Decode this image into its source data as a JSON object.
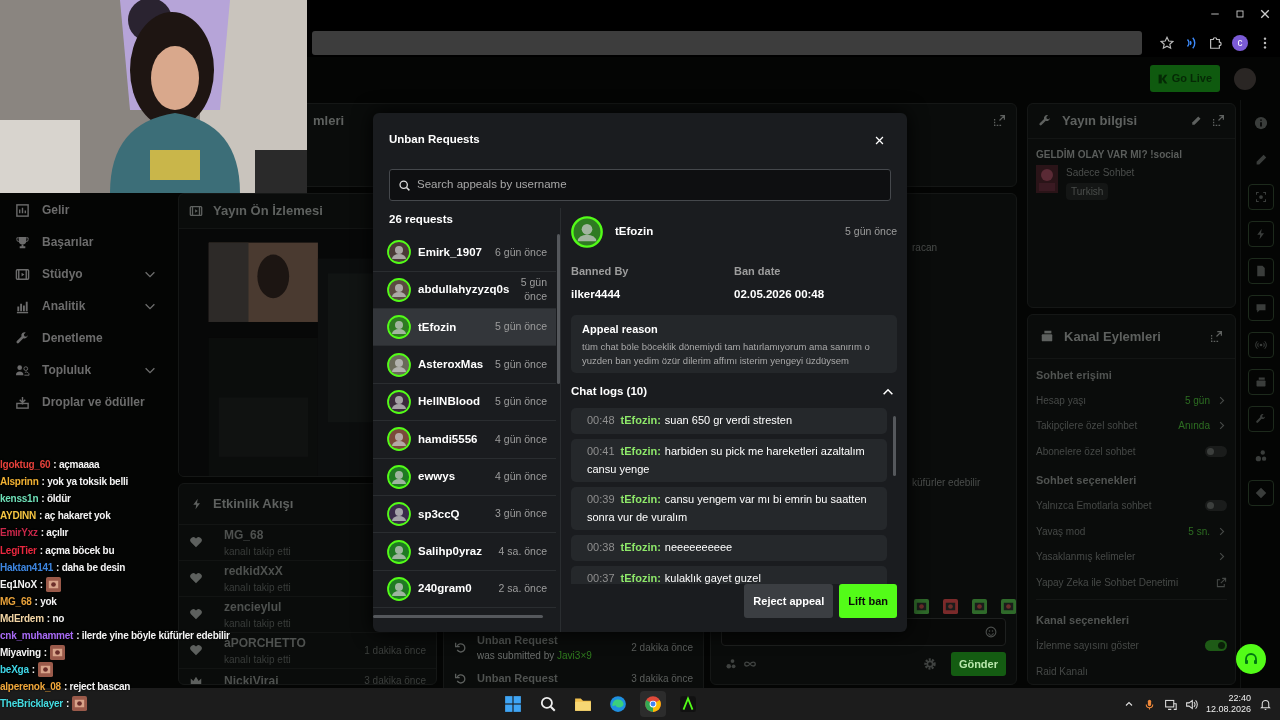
{
  "browser": {
    "profile_initial": "c"
  },
  "header": {
    "go_live": "Go Live"
  },
  "sidebar": {
    "items": [
      {
        "label": "Gelir",
        "expandable": false
      },
      {
        "label": "Başarılar",
        "expandable": false
      },
      {
        "label": "Stüdyo",
        "expandable": true
      },
      {
        "label": "Analitik",
        "expandable": true
      },
      {
        "label": "Denetleme",
        "expandable": false
      },
      {
        "label": "Topluluk",
        "expandable": true
      },
      {
        "label": "Droplar ve ödüller",
        "expandable": false
      }
    ]
  },
  "top_panel": {
    "title": "mleri"
  },
  "preview": {
    "title": "Yayın Ön İzlemesi"
  },
  "activity": {
    "title": "Etkinlik Akışı",
    "items": [
      {
        "kind": "follow",
        "name": "MG_68",
        "action": "kanalı takip etti"
      },
      {
        "kind": "follow",
        "name": "redkidXxX",
        "action": "kanalı takip etti"
      },
      {
        "kind": "follow",
        "name": "zencieylul",
        "action": "kanalı takip etti"
      },
      {
        "kind": "follow",
        "name": "aPORCHETTO",
        "action": "kanalı takip etti",
        "time": "1 dakika önce"
      },
      {
        "kind": "subscription",
        "name": "NickiVirai",
        "time": "3 dakika önce"
      }
    ]
  },
  "mod_log": {
    "items": [
      {
        "title": "Unban Request",
        "detail": "was submitted by",
        "user": "Javi3×9",
        "time": "2 dakika önce"
      },
      {
        "title": "Unban Request",
        "time": "3 dakika önce"
      }
    ]
  },
  "chat": {
    "messages": [
      "racan",
      "küfürler edebilir"
    ],
    "send": "Gönder"
  },
  "stream_info": {
    "title": "Yayın bilgisi",
    "stream_title": "GELDİM OLAY VAR MI? !social",
    "category": "Sadece Sohbet",
    "tag": "Turkish"
  },
  "channel_actions": {
    "title": "Kanal Eylemleri",
    "sections": [
      {
        "heading": "Sohbet erişimi",
        "rows": [
          {
            "kind": "value",
            "label": "Hesap yaşı",
            "value": "5 gün"
          },
          {
            "kind": "value",
            "label": "Takipçilere özel sohbet",
            "value": "Anında"
          },
          {
            "kind": "toggle",
            "label": "Abonelere özel sohbet",
            "on": false
          }
        ]
      },
      {
        "heading": "Sohbet seçenekleri",
        "rows": [
          {
            "kind": "toggle",
            "label": "Yalnızca Emotlarla sohbet",
            "on": false
          },
          {
            "kind": "value",
            "label": "Yavaş mod",
            "value": "5 sn."
          },
          {
            "kind": "link",
            "label": "Yasaklanmış kelimeler"
          },
          {
            "kind": "external",
            "label": "Yapay Zeka ile Sohbet Denetimi"
          }
        ]
      },
      {
        "heading": "Kanal seçenekleri",
        "rows": [
          {
            "kind": "toggle",
            "label": "İzlenme sayısını göster",
            "on": true
          },
          {
            "kind": "plain",
            "label": "Raid Kanalı"
          }
        ]
      }
    ]
  },
  "stream_chat": [
    {
      "user": "lgoktug_60",
      "color": "#e5413b",
      "message": ": açmaaaa"
    },
    {
      "user": "Alsprinn",
      "color": "#f2b233",
      "message": ": yok ya toksik belli"
    },
    {
      "user": "kenss1n",
      "color": "#6fe0b8",
      "message": ": öldür"
    },
    {
      "user": "AYDINN",
      "color": "#f5c542",
      "message": ": aç hakaret yok"
    },
    {
      "user": "EmirYxz",
      "color": "#c9284a",
      "message": ": açılır"
    },
    {
      "user": "LegiTier",
      "color": "#e8283f",
      "message": ": açma böcek bu"
    },
    {
      "user": "Haktan4141",
      "color": "#3d86e0",
      "message": ": daha be desin"
    },
    {
      "user": "Eq1NoX",
      "color": "#f2f2f2",
      "message": ":",
      "emote": true
    },
    {
      "user": "MG_68",
      "color": "#e8a23a",
      "message": ": yok"
    },
    {
      "user": "MdErdem",
      "color": "#f3d6a5",
      "message": ": no"
    },
    {
      "user": "cnk_muhammet",
      "color": "#a86bf5",
      "message": ": ilerde yine böyle küfürler edebilir"
    },
    {
      "user": "Miyaving",
      "color": "#f2f2f2",
      "message": ":",
      "emote": true
    },
    {
      "user": "beXga",
      "color": "#3fd6e6",
      "message": ":",
      "emote": true
    },
    {
      "user": "alperenok_08",
      "color": "#f0a73a",
      "message": ": reject bascan"
    },
    {
      "user": "TheBricklayer",
      "color": "#45dde3",
      "message": ":",
      "emote": true
    }
  ],
  "modal": {
    "title": "Unban Requests",
    "search": {
      "placeholder": "Search appeals by username"
    },
    "count": "26 requests",
    "requests": [
      {
        "name": "Emirk_1907",
        "time": "6 gün önce",
        "selected": false
      },
      {
        "name": "abdullahyzyzq0s",
        "time": "5 gün önce",
        "selected": false
      },
      {
        "name": "tEfozin",
        "time": "5 gün önce",
        "selected": true
      },
      {
        "name": "AsteroxMas",
        "time": "5 gün önce",
        "selected": false
      },
      {
        "name": "HellNBlood",
        "time": "5 gün önce",
        "selected": false
      },
      {
        "name": "hamdi5556",
        "time": "4 gün önce",
        "selected": false
      },
      {
        "name": "ewwys",
        "time": "4 gün önce",
        "selected": false
      },
      {
        "name": "sp3ccQ",
        "time": "3 gün önce",
        "selected": false
      },
      {
        "name": "Salihp0yraz",
        "time": "4 sa. önce",
        "selected": false
      },
      {
        "name": "240gram0",
        "time": "2 sa. önce",
        "selected": false
      }
    ],
    "detail": {
      "name": "tEfozin",
      "time": "5 gün önce",
      "banned_by_label": "Banned By",
      "banned_by": "ilker4444",
      "ban_date_label": "Ban date",
      "ban_date": "02.05.2026 00:48",
      "appeal_title": "Appeal reason",
      "appeal_text": "tüm chat böle böceklik dönemiydi tam hatırlamıyorum ama sanırım o yuzden ban yedim özür dilerim affımı isterim yengeyi üzdüysem",
      "logs_title": "Chat logs (10)",
      "logs_expanded": true,
      "logs": [
        {
          "time": "00:48",
          "user": "tEfozin:",
          "text": "suan 650 gr verdi stresten"
        },
        {
          "time": "00:41",
          "user": "tEfozin:",
          "text": "harbiden su pick me hareketleri azaltalım cansu yenge"
        },
        {
          "time": "00:39",
          "user": "tEfozin:",
          "text": "cansu yengem var mı bi emrin bu saatten sonra vur de vuralım"
        },
        {
          "time": "00:38",
          "user": "tEfozin:",
          "text": "neeeeeeeeee"
        },
        {
          "time": "00:37",
          "user": "tEfozin:",
          "text": "kulaklık gayet guzel"
        }
      ]
    },
    "buttons": [
      {
        "kind": "secondary",
        "label": "Reject appeal"
      },
      {
        "kind": "primary",
        "label": "Lift ban"
      }
    ]
  },
  "taskbar": {
    "time": "22:40",
    "date": "12.08.2026"
  }
}
